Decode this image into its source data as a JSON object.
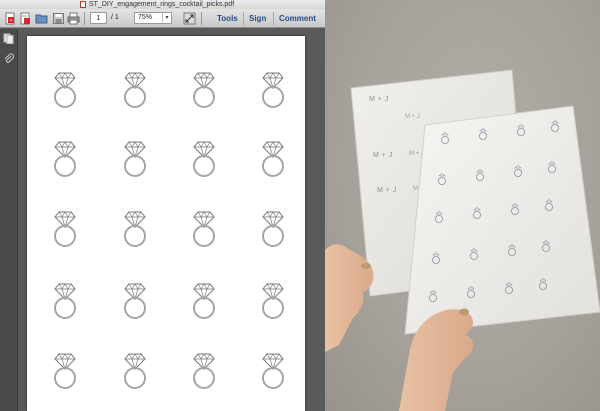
{
  "window": {
    "title": "ST_DIY_engagement_rings_cocktail_picks.pdf"
  },
  "toolbar": {
    "page_number": "1",
    "page_total": "/ 1",
    "zoom": "75%",
    "links": [
      "Tools",
      "Sign",
      "Comment"
    ]
  },
  "icons": {
    "toolbar": [
      "create-pdf-icon",
      "edit-pdf-icon",
      "open-folder-icon",
      "save-icon",
      "print-icon",
      "fit-page-icon"
    ],
    "rail": [
      "pages-panel-icon",
      "attachments-icon"
    ]
  },
  "pdf_page": {
    "ring_grid": {
      "columns": 4,
      "rows": 5,
      "icon": "diamond-ring-icon"
    }
  },
  "photo": {
    "monograms": [
      "M + J",
      "M + J",
      "M + J"
    ]
  },
  "colors": {
    "viewer_background": "#5a5a5a",
    "link_blue": "#2b4e86",
    "ring_gray": "#9a9a9a",
    "wall": "#a9a49d"
  }
}
